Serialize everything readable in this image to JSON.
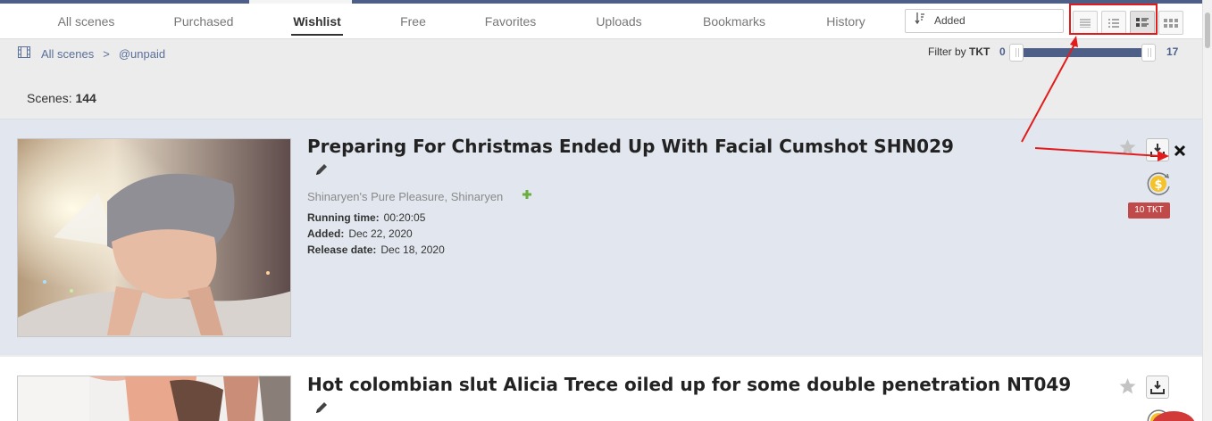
{
  "nav": {
    "tabs": [
      "All scenes",
      "Purchased",
      "Wishlist",
      "Free",
      "Favorites",
      "Uploads",
      "Bookmarks",
      "History"
    ],
    "active_tab": "Wishlist",
    "sort_value": "Added"
  },
  "breadcrumb": {
    "root": "All scenes",
    "separator": ">",
    "current": "@unpaid"
  },
  "filter": {
    "label": "Filter by",
    "unit": "TKT",
    "min": "0",
    "max": "17",
    "range_low": 0,
    "range_high": 17
  },
  "scenes": {
    "label": "Scenes:",
    "count": "144"
  },
  "items": [
    {
      "title": "Preparing For Christmas Ended Up With Facial Cumshot SHN029",
      "studios": "Shinaryen's Pure Pleasure,  Shinaryen",
      "running_time_label": "Running time:",
      "running_time": "00:20:05",
      "added_label": "Added:",
      "added": "Dec 22, 2020",
      "release_label": "Release date:",
      "release": "Dec 18, 2020",
      "price": "10 TKT"
    },
    {
      "title": "Hot colombian slut Alicia Trece oiled up for some double penetration NT049"
    }
  ],
  "icons": {
    "edit": "pencil-icon",
    "add": "plus-icon",
    "favorite": "star-icon",
    "download": "download-icon",
    "remove": "close-icon",
    "purchase": "coin-icon",
    "breadcrumb": "film-icon",
    "sort": "sort-icon"
  },
  "colors": {
    "accent": "#4d5f86",
    "price_badge": "#c0494a",
    "annotation": "#e21c1c"
  }
}
